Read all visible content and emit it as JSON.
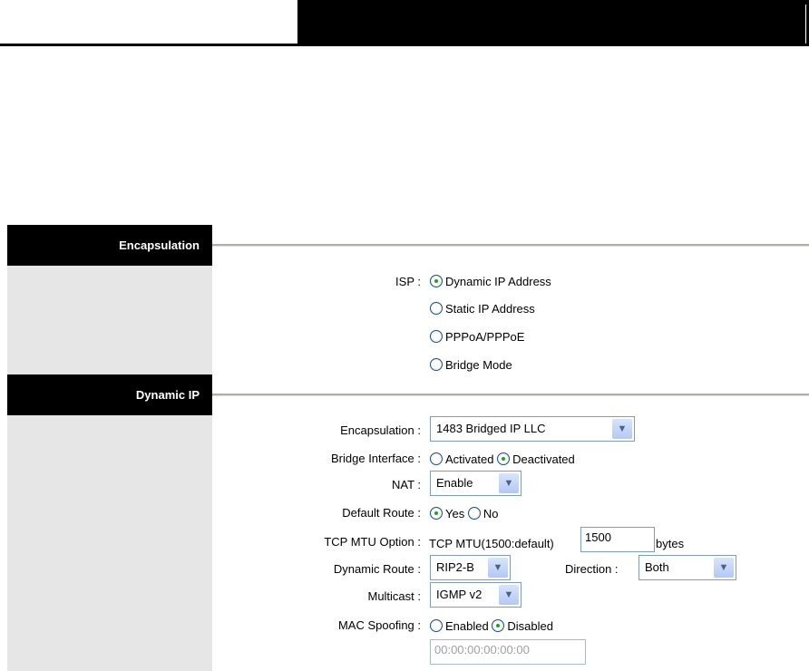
{
  "sections": {
    "encapsulation": "Encapsulation",
    "dynamic_ip": "Dynamic IP"
  },
  "isp": {
    "label": "ISP :",
    "options": [
      "Dynamic IP Address",
      "Static IP Address",
      "PPPoA/PPPoE",
      "Bridge Mode"
    ],
    "selected": "Dynamic IP Address"
  },
  "form": {
    "encapsulation": {
      "label": "Encapsulation :",
      "value": "1483 Bridged IP LLC"
    },
    "bridge_interface": {
      "label": "Bridge Interface :",
      "options": [
        "Activated",
        "Deactivated"
      ],
      "selected": "Deactivated"
    },
    "nat": {
      "label": "NAT :",
      "value": "Enable"
    },
    "default_route": {
      "label": "Default Route :",
      "options": [
        "Yes",
        "No"
      ],
      "selected": "Yes"
    },
    "tcp_mtu": {
      "label": "TCP MTU Option :",
      "prefix": "TCP MTU(1500:default)",
      "value": "1500",
      "suffix": "bytes"
    },
    "dynamic_route": {
      "label": "Dynamic Route :",
      "value": "RIP2-B"
    },
    "direction": {
      "label": "Direction :",
      "value": "Both"
    },
    "multicast": {
      "label": "Multicast :",
      "value": "IGMP v2"
    },
    "mac_spoofing": {
      "label": "MAC Spoofing :",
      "options": [
        "Enabled",
        "Disabled"
      ],
      "selected": "Disabled",
      "placeholder": "00:00:00:00:00:00"
    }
  }
}
